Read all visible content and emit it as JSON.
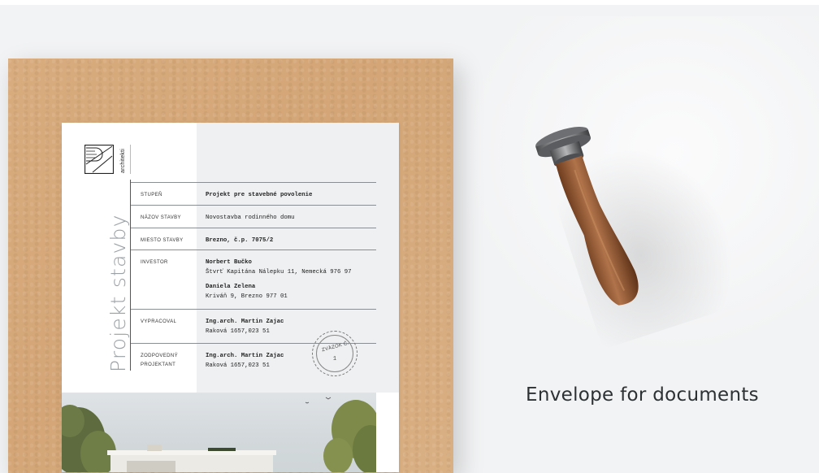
{
  "logo": {
    "text": "architekti"
  },
  "document": {
    "vertical_title": "Projekt stavby",
    "rows": [
      {
        "label": "STUPEŇ",
        "lines": [
          {
            "text": "Projekt pre stavebné povolenie",
            "bold": true
          }
        ]
      },
      {
        "label": "NÁZOV STAVBY",
        "lines": [
          {
            "text": "Novostavba rodinného domu",
            "bold": false
          }
        ]
      },
      {
        "label": "MIESTO STAVBY",
        "lines": [
          {
            "text": "Brezno, č.p. 7075/2",
            "bold": true
          }
        ]
      },
      {
        "label": "INVESTOR",
        "lines": [
          {
            "text": "Norbert Bučko",
            "bold": true
          },
          {
            "text": "Štvrť Kapitána Nálepku 11, Nemecká 976 97",
            "bold": false
          },
          {
            "text": "Daniela Zelena",
            "bold": true
          },
          {
            "text": "Kriváň 9, Brezno 977 01",
            "bold": false
          }
        ]
      },
      {
        "label": "VYPRACOVAL",
        "lines": [
          {
            "text": "Ing.arch. Martin Zajac",
            "bold": true
          },
          {
            "text": "Raková 1657,023 51",
            "bold": false
          }
        ]
      },
      {
        "label": "ZODPOVEDNÝ PROJEKTANT",
        "lines": [
          {
            "text": "Ing.arch. Martin Zajac",
            "bold": true
          },
          {
            "text": "Raková 1657,023 51",
            "bold": false
          }
        ]
      }
    ],
    "stamp": {
      "top_text": "ZVÄZOK Č.",
      "number": "1"
    }
  },
  "caption": "Envelope for documents",
  "colors": {
    "envelope": "#d6a97a",
    "background": "#f2f3f4",
    "text": "#2d3134"
  }
}
